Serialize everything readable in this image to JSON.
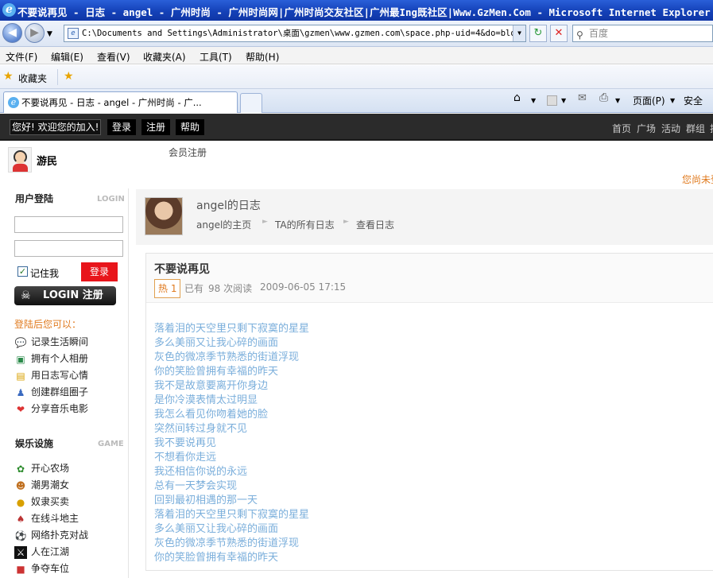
{
  "window": {
    "title": "不要说再见 - 日志 - angel - 广州时尚 - 广州时尚网|广州时尚交友社区|广州最Ing既社区|Www.GzMen.Com - Microsoft Internet Explorer"
  },
  "browser": {
    "address": "C:\\Documents and Settings\\Administrator\\桌面\\gzmen\\www.gzmen.com\\space.php-uid=4&do=blog&",
    "search_placeholder": "百度",
    "menu": [
      "文件(F)",
      "编辑(E)",
      "查看(V)",
      "收藏夹(A)",
      "工具(T)",
      "帮助(H)"
    ],
    "favorites_label": "收藏夹",
    "tab_title": "不要说再见 - 日志 - angel - 广州时尚 - 广...",
    "commands": {
      "page": "页面(P)",
      "safety": "安全"
    }
  },
  "site": {
    "welcome": "您好! 欢迎您的加入!",
    "login": "登录",
    "register": "注册",
    "help": "帮助",
    "nav": [
      "首页",
      "广场",
      "活动",
      "群组",
      "排"
    ],
    "username": "游民",
    "member_register": "会员注册",
    "notice": "您尚未登"
  },
  "sidebar": {
    "login_title": "用户登陆",
    "login_title_en": "LOGIN",
    "remember": "记住我",
    "login_button": "登录",
    "login_banner": "LOGIN 注册",
    "after_login": "登陆后您可以：",
    "features": [
      "记录生活瞬间",
      "拥有个人相册",
      "用日志写心情",
      "创建群组圈子",
      "分享音乐电影"
    ],
    "game_title": "娱乐设施",
    "game_title_en": "GAME",
    "games": [
      "开心农场",
      "潮男潮女",
      "奴隶买卖",
      "在线斗地主",
      "网络扑克对战",
      "人在江湖",
      "争夺车位"
    ]
  },
  "blog": {
    "header_title": "angel的日志",
    "links": [
      "angel的主页",
      "TA的所有日志",
      "查看日志"
    ],
    "article_title": "不要说再见",
    "hot_badge": "热 1",
    "meta_prefix": "已有",
    "views": "98 次阅读",
    "date": "2009-06-05 17:15",
    "lines": [
      "落着泪的天空里只剩下寂寞的星星",
      "多么美丽又让我心碎的画面",
      "灰色的微凉季节熟悉的街道浮现",
      "你的笑脸曾拥有幸福的昨天",
      "我不是故意要离开你身边",
      "是你冷漠表情太过明显",
      "我怎么看见你吻着她的脸",
      "突然间转过身就不见",
      "我不要说再见",
      "不想看你走远",
      "我还相信你说的永远",
      "总有一天梦会实现",
      "回到最初相遇的那一天",
      "落着泪的天空里只剩下寂寞的星星",
      "多么美丽又让我心碎的画面",
      "灰色的微凉季节熟悉的街道浮现",
      "你的笑脸曾拥有幸福的昨天"
    ]
  },
  "colors": {
    "site_bar": "#2b2b2b",
    "login_red": "#e8151b",
    "lyric": "#7aaedb",
    "orange_text": "#e07a1e"
  }
}
